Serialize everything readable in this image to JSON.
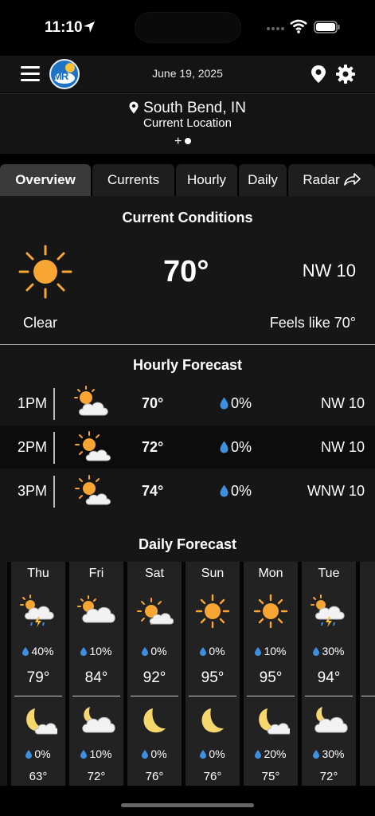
{
  "status": {
    "time": "11:10"
  },
  "header": {
    "logo_text": "MR",
    "date": "June 19, 2025"
  },
  "location": {
    "name": "South Bend, IN",
    "subtitle": "Current Location",
    "add": "+"
  },
  "tabs": [
    {
      "label": "Overview",
      "active": true
    },
    {
      "label": "Currents"
    },
    {
      "label": "Hourly"
    },
    {
      "label": "Daily"
    },
    {
      "label": "Radar"
    }
  ],
  "current": {
    "title": "Current Conditions",
    "icon": "sun-icon",
    "temp": "70°",
    "wind": "NW 10",
    "condition": "Clear",
    "feels_like": "Feels like 70°"
  },
  "hourly": {
    "title": "Hourly Forecast",
    "rows": [
      {
        "time": "1PM",
        "icon": "partly-cloudy-icon",
        "temp": "70°",
        "precip": "0%",
        "wind": "NW 10"
      },
      {
        "time": "2PM",
        "icon": "partly-cloudy-icon",
        "temp": "72°",
        "precip": "0%",
        "wind": "NW 10"
      },
      {
        "time": "3PM",
        "icon": "partly-cloudy-icon",
        "temp": "74°",
        "precip": "0%",
        "wind": "WNW 10"
      }
    ]
  },
  "daily": {
    "title": "Daily Forecast",
    "days": [
      {
        "name": "Thu",
        "day_icon": "thunderstorm-icon",
        "day_precip": "40%",
        "high": "79°",
        "night_icon": "moon-cloud-icon",
        "night_precip": "0%",
        "low": "63°"
      },
      {
        "name": "Fri",
        "day_icon": "mostly-cloudy-icon",
        "day_precip": "10%",
        "high": "84°",
        "night_icon": "cloudy-night-icon",
        "night_precip": "10%",
        "low": "72°"
      },
      {
        "name": "Sat",
        "day_icon": "partly-cloudy-icon",
        "day_precip": "0%",
        "high": "92°",
        "night_icon": "moon-icon",
        "night_precip": "0%",
        "low": "76°"
      },
      {
        "name": "Sun",
        "day_icon": "sun-icon",
        "day_precip": "0%",
        "high": "95°",
        "night_icon": "moon-icon",
        "night_precip": "0%",
        "low": "76°"
      },
      {
        "name": "Mon",
        "day_icon": "sun-icon",
        "day_precip": "10%",
        "high": "95°",
        "night_icon": "moon-cloud-icon",
        "night_precip": "20%",
        "low": "75°"
      },
      {
        "name": "Tue",
        "day_icon": "thunderstorm-icon",
        "day_precip": "30%",
        "high": "94°",
        "night_icon": "cloudy-night-icon",
        "night_precip": "30%",
        "low": "72°"
      }
    ]
  },
  "colors": {
    "sun": "#f7a533",
    "drop": "#3d8fe0",
    "cloud": "#f2f2f2",
    "moon": "#f5d76e"
  }
}
